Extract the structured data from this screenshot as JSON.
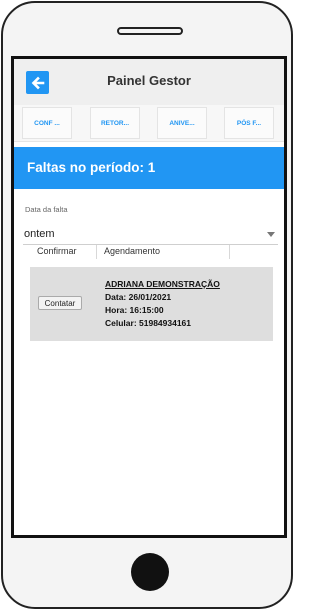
{
  "header": {
    "title": "Painel Gestor",
    "back_icon": "arrow-left-icon"
  },
  "menu": {
    "items": [
      {
        "label": "CONF ..."
      },
      {
        "label": "RETOR..."
      },
      {
        "label": "ANIVE..."
      },
      {
        "label": "PÓS F..."
      }
    ]
  },
  "banner": {
    "text": "Faltas no período: 1"
  },
  "filter": {
    "label": "Data da falta",
    "selected": "ontem"
  },
  "table": {
    "columns": [
      "Confirmar",
      "Agendamento"
    ]
  },
  "record": {
    "button_label": "Contatar",
    "name": "ADRIANA DEMONSTRAÇÃO",
    "data": "Data: 26/01/2021",
    "hora": "Hora: 16:15:00",
    "celular": "Celular: 51984934161"
  },
  "colors": {
    "accent": "#2196f3",
    "card": "#dedede"
  }
}
